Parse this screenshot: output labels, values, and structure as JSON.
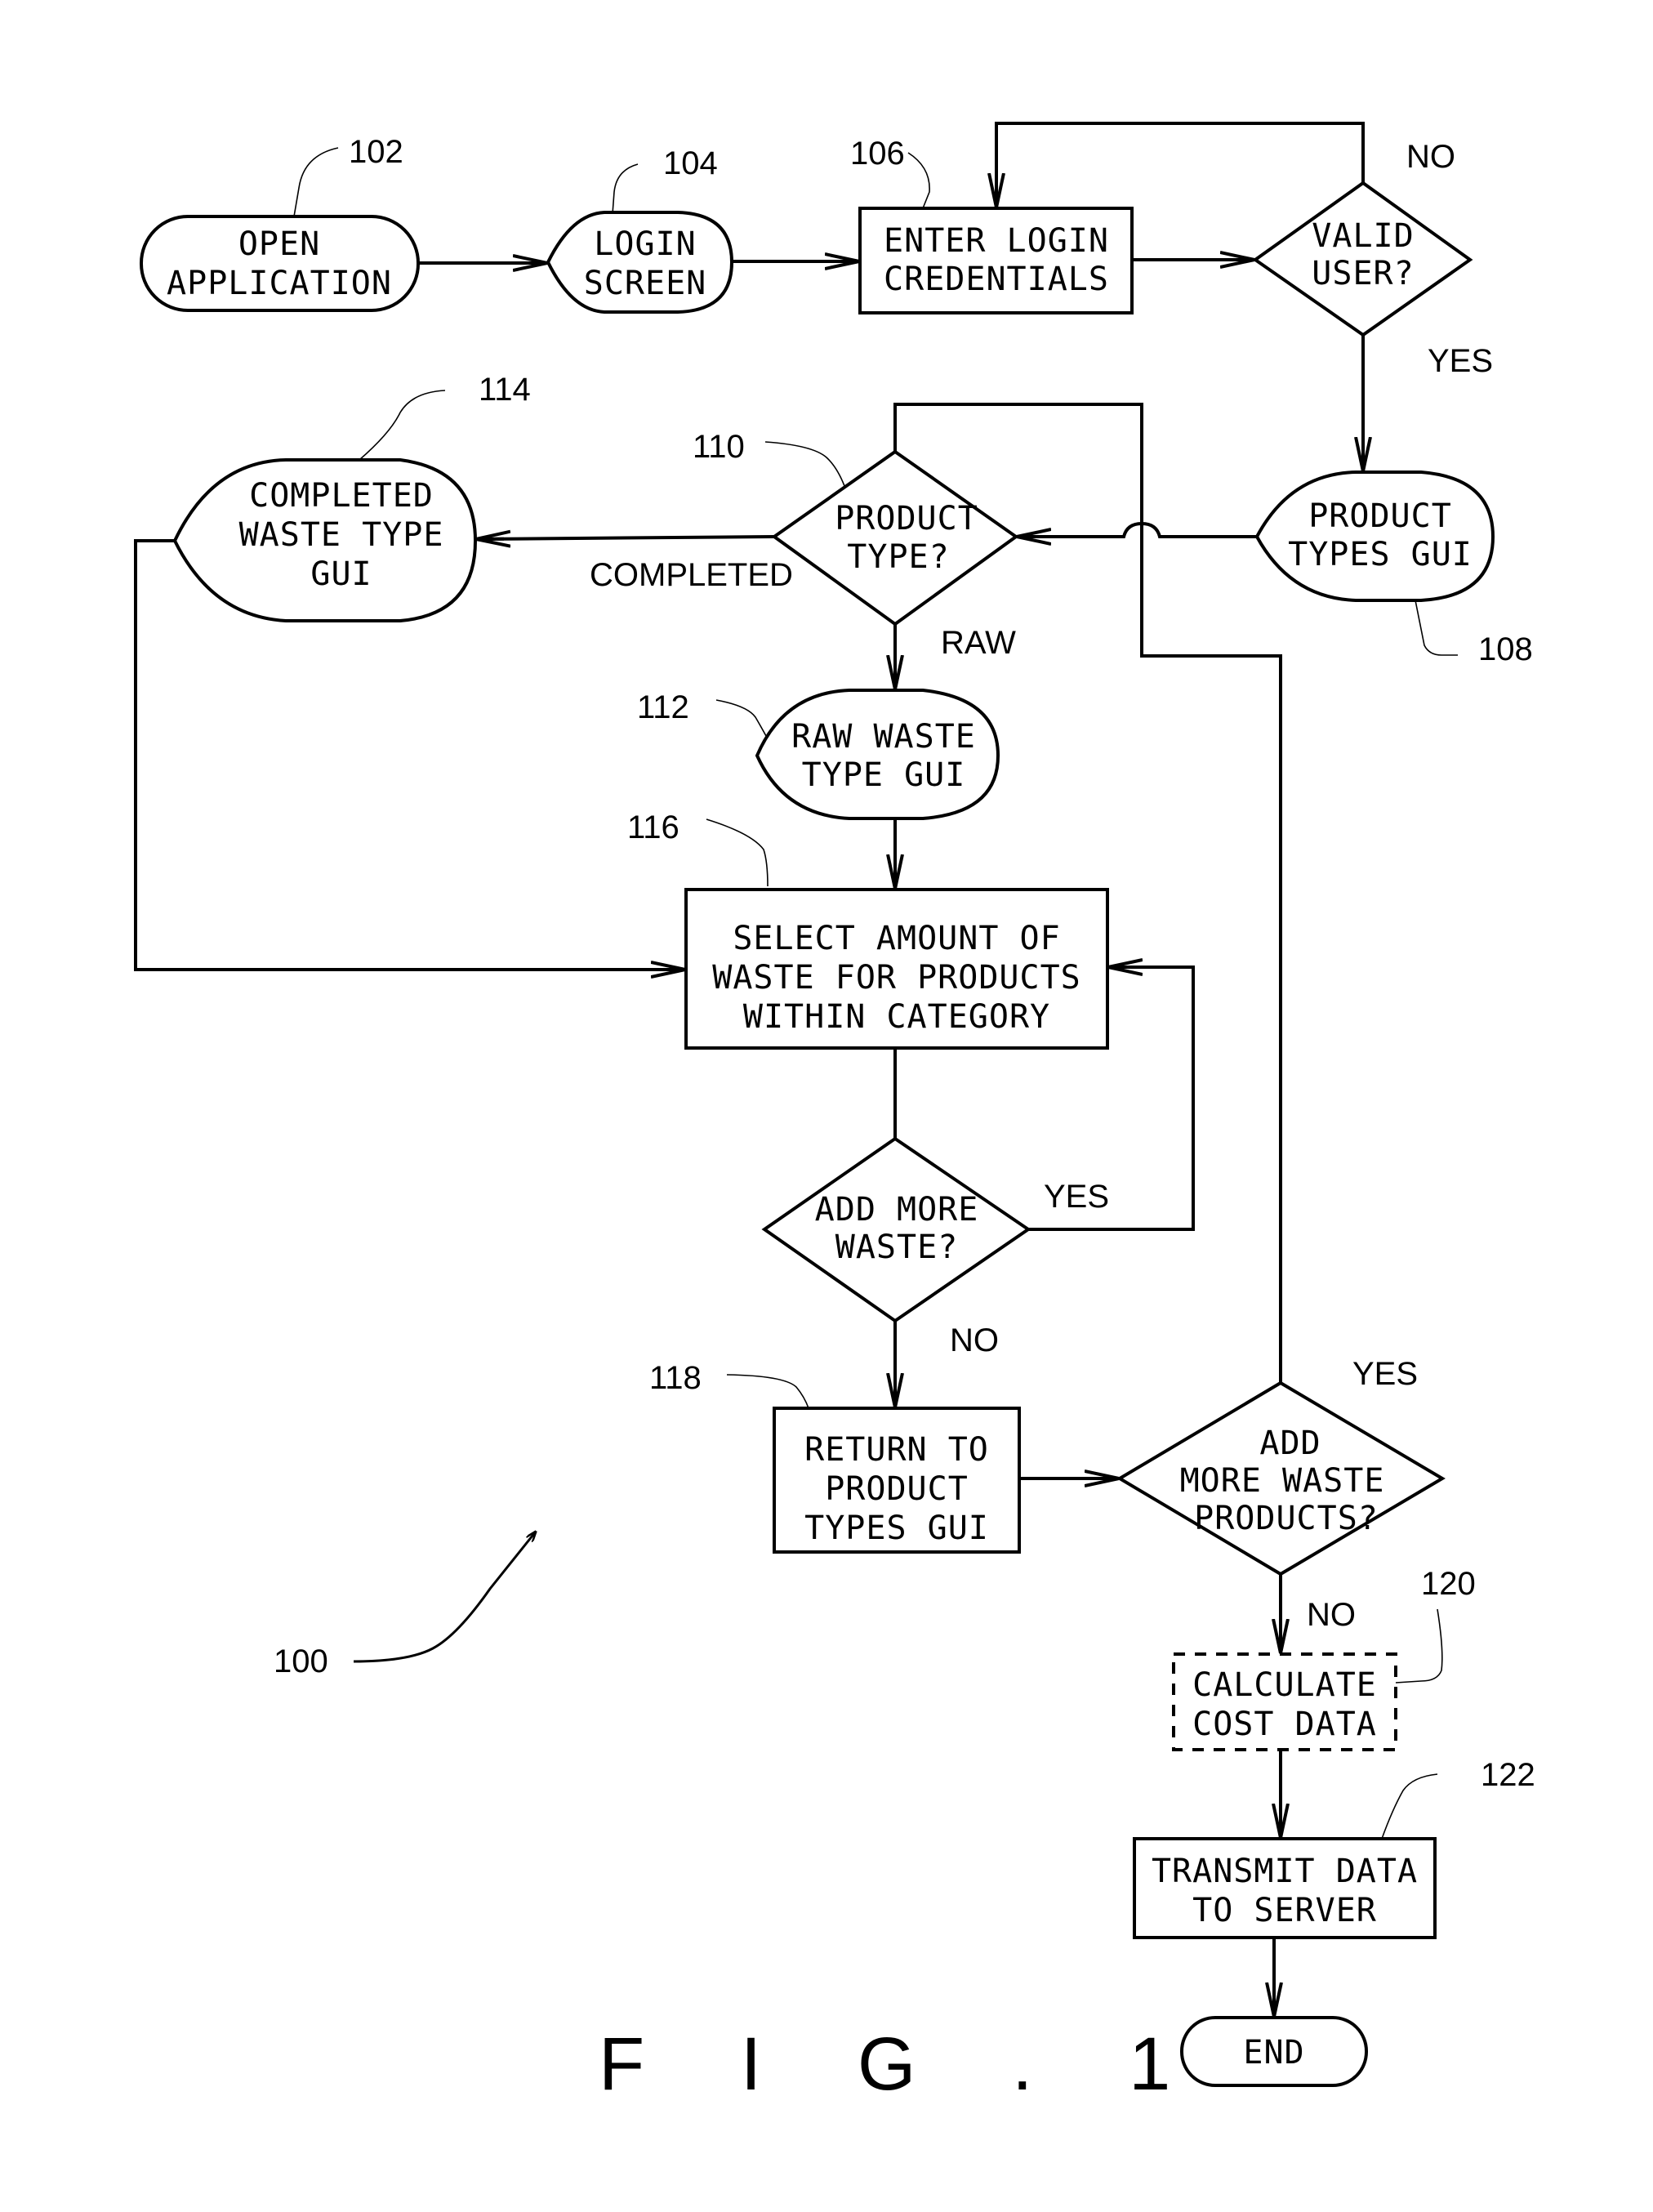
{
  "figure": {
    "caption": "F I G . 1",
    "reference": "100"
  },
  "nodes": {
    "open_application": {
      "ref": "102",
      "shape": "terminal",
      "lines": [
        "OPEN",
        "APPLICATION"
      ]
    },
    "login_screen": {
      "ref": "104",
      "shape": "display",
      "lines": [
        "LOGIN",
        "SCREEN"
      ]
    },
    "enter_login": {
      "ref": "106",
      "shape": "process",
      "lines": [
        "ENTER LOGIN",
        "CREDENTIALS"
      ]
    },
    "valid_user": {
      "ref": "",
      "shape": "decision",
      "lines": [
        "VALID",
        "USER?"
      ]
    },
    "product_types_gui": {
      "ref": "108",
      "shape": "display",
      "lines": [
        "PRODUCT",
        "TYPES GUI"
      ]
    },
    "product_type": {
      "ref": "110",
      "shape": "decision",
      "lines": [
        "PRODUCT",
        "TYPE?"
      ]
    },
    "raw_waste_gui": {
      "ref": "112",
      "shape": "display",
      "lines": [
        "RAW WASTE",
        "TYPE GUI"
      ]
    },
    "completed_waste_gui": {
      "ref": "114",
      "shape": "display",
      "lines": [
        "COMPLETED",
        "WASTE TYPE",
        "GUI"
      ]
    },
    "select_amount": {
      "ref": "116",
      "shape": "process",
      "lines": [
        "SELECT AMOUNT OF",
        "WASTE FOR PRODUCTS",
        "WITHIN CATEGORY"
      ]
    },
    "add_more_waste": {
      "ref": "",
      "shape": "decision",
      "lines": [
        "ADD MORE",
        "WASTE?"
      ]
    },
    "return_to_product": {
      "ref": "118",
      "shape": "process",
      "lines": [
        "RETURN TO",
        "PRODUCT",
        "TYPES GUI"
      ]
    },
    "add_more_products": {
      "ref": "",
      "shape": "decision",
      "lines": [
        "ADD",
        "MORE WASTE",
        "PRODUCTS?"
      ]
    },
    "calculate_cost": {
      "ref": "120",
      "shape": "optional-process",
      "lines": [
        "CALCULATE",
        "COST DATA"
      ]
    },
    "transmit_data": {
      "ref": "122",
      "shape": "process",
      "lines": [
        "TRANSMIT DATA",
        "TO SERVER"
      ]
    },
    "end": {
      "ref": "",
      "shape": "terminal",
      "lines": [
        "END"
      ]
    }
  },
  "edges": [
    {
      "from": "open_application",
      "to": "login_screen",
      "label": ""
    },
    {
      "from": "login_screen",
      "to": "enter_login",
      "label": ""
    },
    {
      "from": "enter_login",
      "to": "valid_user",
      "label": ""
    },
    {
      "from": "valid_user",
      "to": "enter_login",
      "label": "NO"
    },
    {
      "from": "valid_user",
      "to": "product_types_gui",
      "label": "YES"
    },
    {
      "from": "product_types_gui",
      "to": "product_type",
      "label": ""
    },
    {
      "from": "product_type",
      "to": "completed_waste_gui",
      "label": "COMPLETED"
    },
    {
      "from": "product_type",
      "to": "raw_waste_gui",
      "label": "RAW"
    },
    {
      "from": "raw_waste_gui",
      "to": "select_amount",
      "label": ""
    },
    {
      "from": "completed_waste_gui",
      "to": "select_amount",
      "label": ""
    },
    {
      "from": "select_amount",
      "to": "add_more_waste",
      "label": ""
    },
    {
      "from": "add_more_waste",
      "to": "select_amount",
      "label": "YES"
    },
    {
      "from": "add_more_waste",
      "to": "return_to_product",
      "label": "NO"
    },
    {
      "from": "return_to_product",
      "to": "add_more_products",
      "label": ""
    },
    {
      "from": "add_more_products",
      "to": "product_type",
      "label": "YES"
    },
    {
      "from": "add_more_products",
      "to": "calculate_cost",
      "label": "NO"
    },
    {
      "from": "calculate_cost",
      "to": "transmit_data",
      "label": ""
    },
    {
      "from": "transmit_data",
      "to": "end",
      "label": ""
    }
  ],
  "branch_labels": {
    "valid_no": "NO",
    "valid_yes": "YES",
    "type_completed": "COMPLETED",
    "type_raw": "RAW",
    "more_waste_yes": "YES",
    "more_waste_no": "NO",
    "more_products_yes": "YES",
    "more_products_no": "NO"
  }
}
